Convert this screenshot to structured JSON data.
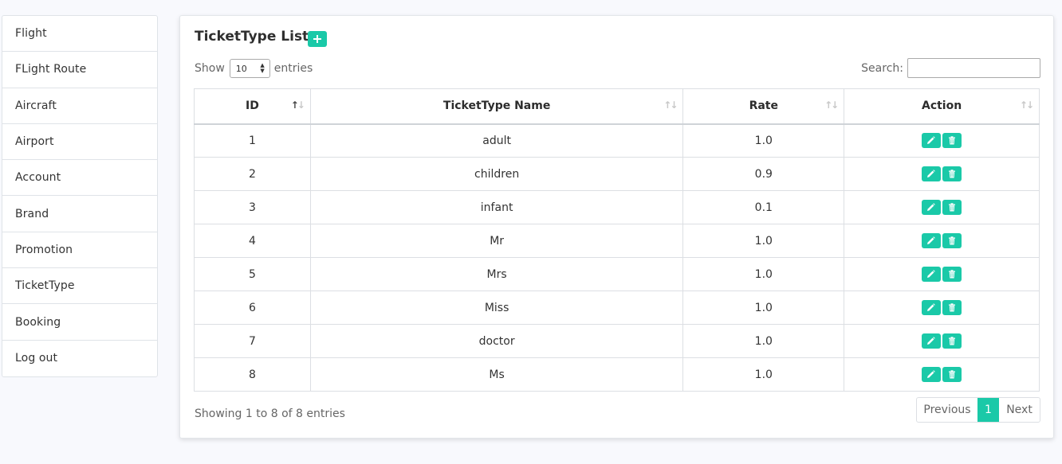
{
  "sidebar": {
    "items": [
      {
        "label": "Flight"
      },
      {
        "label": "FLight Route"
      },
      {
        "label": "Aircraft"
      },
      {
        "label": "Airport"
      },
      {
        "label": "Account"
      },
      {
        "label": "Brand"
      },
      {
        "label": "Promotion"
      },
      {
        "label": "TicketType"
      },
      {
        "label": "Booking"
      },
      {
        "label": "Log out"
      }
    ]
  },
  "main": {
    "title": "TicketType List",
    "show_label": "Show",
    "entries_value": "10",
    "entries_label": "entries",
    "search_label": "Search:",
    "search_value": "",
    "columns": [
      "ID",
      "TicketType Name",
      "Rate",
      "Action"
    ],
    "rows": [
      {
        "id": "1",
        "name": "adult",
        "rate": "1.0"
      },
      {
        "id": "2",
        "name": "children",
        "rate": "0.9"
      },
      {
        "id": "3",
        "name": "infant",
        "rate": "0.1"
      },
      {
        "id": "4",
        "name": "Mr",
        "rate": "1.0"
      },
      {
        "id": "5",
        "name": "Mrs",
        "rate": "1.0"
      },
      {
        "id": "6",
        "name": "Miss",
        "rate": "1.0"
      },
      {
        "id": "7",
        "name": "doctor",
        "rate": "1.0"
      },
      {
        "id": "8",
        "name": "Ms",
        "rate": "1.0"
      }
    ],
    "info": "Showing 1 to 8 of 8 entries",
    "pagination": {
      "previous": "Previous",
      "current": "1",
      "next": "Next"
    }
  },
  "colors": {
    "accent": "#1ac9a8",
    "background": "#f8f9fd"
  },
  "icons": {
    "add": "plus-icon",
    "edit": "pencil-icon",
    "delete": "trash-icon",
    "sort": "sort-arrows-icon"
  }
}
